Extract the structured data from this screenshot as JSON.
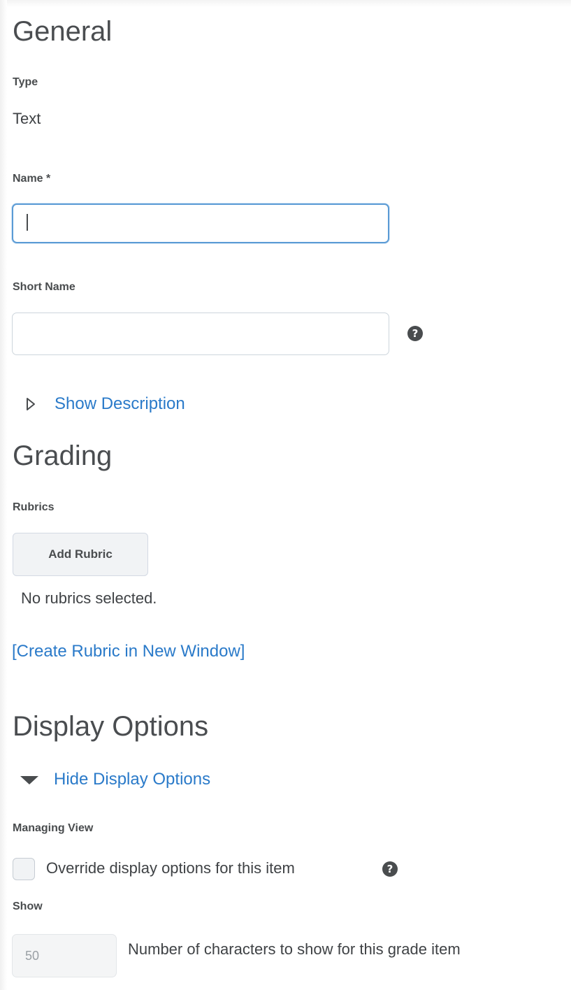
{
  "general": {
    "heading": "General",
    "type_label": "Type",
    "type_value": "Text",
    "name_label": "Name *",
    "name_value": "",
    "short_name_label": "Short Name",
    "short_name_value": "",
    "short_name_help_icon": "help-icon",
    "show_description_link": "Show Description",
    "show_description_icon": "triangle-right-outline-icon"
  },
  "grading": {
    "heading": "Grading",
    "rubrics_label": "Rubrics",
    "add_rubric_button": "Add Rubric",
    "no_rubrics_text": "No rubrics selected.",
    "create_rubric_link": "[Create Rubric in New Window]"
  },
  "display_options": {
    "heading": "Display Options",
    "hide_link": "Hide Display Options",
    "hide_icon": "triangle-down-filled-icon",
    "managing_view_label": "Managing View",
    "override_checkbox_label": "Override display options for this item",
    "override_checked": false,
    "override_help_icon": "help-icon",
    "show_label": "Show",
    "characters_value": "50",
    "characters_label": "Number of characters to show for this grade item"
  },
  "colors": {
    "link": "#2a7ac9",
    "focus_border": "#5b9bd5",
    "text": "#494c4e"
  }
}
